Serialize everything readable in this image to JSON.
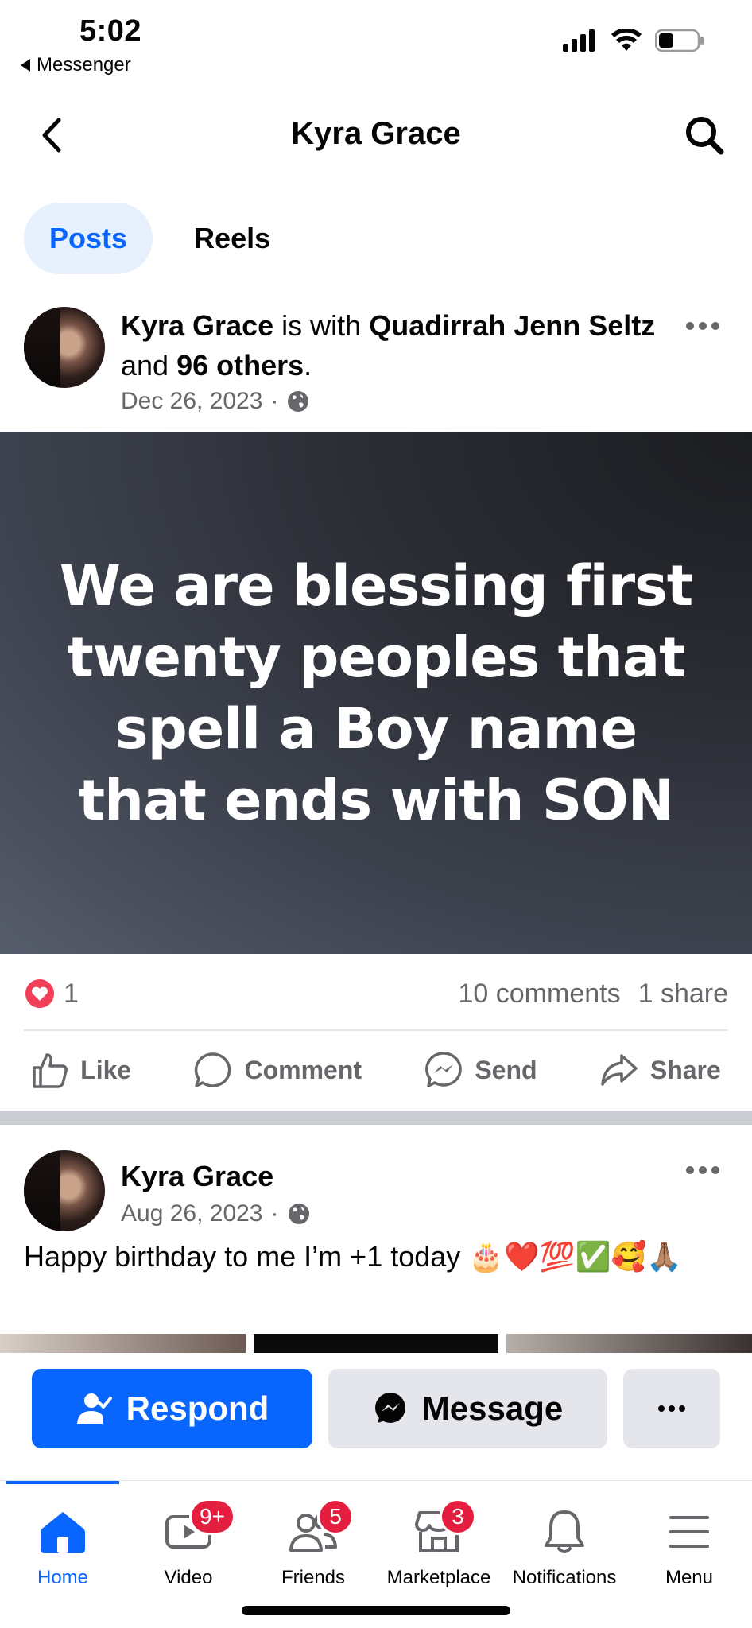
{
  "status_bar": {
    "time": "5:02",
    "back_app": "Messenger"
  },
  "header": {
    "title": "Kyra Grace",
    "back_icon": "chevron-left-icon",
    "search_icon": "search-icon"
  },
  "tabs": [
    {
      "label": "Posts",
      "active": true
    },
    {
      "label": "Reels",
      "active": false
    }
  ],
  "post1": {
    "author": "Kyra Grace",
    "with_text": "is with",
    "tagged": "Quadirrah Jenn Seltz",
    "and_text": "and",
    "others": "96 others",
    "date": "Dec 26, 2023",
    "privacy_icon": "globe-icon",
    "background_text": "We are blessing first twenty peoples that spell a Boy name that ends with SON",
    "reaction_count": "1",
    "comments": "10 comments",
    "shares": "1 share",
    "actions": {
      "like": "Like",
      "comment": "Comment",
      "send": "Send",
      "share": "Share"
    }
  },
  "post2": {
    "author": "Kyra Grace",
    "date": "Aug 26, 2023",
    "text": "Happy birthday to me I’m +1 today 🎂❤️💯✅🥰🙏🏽"
  },
  "cta": {
    "respond": "Respond",
    "message": "Message"
  },
  "tab_bar": [
    {
      "label": "Home",
      "badge": ""
    },
    {
      "label": "Video",
      "badge": "9+"
    },
    {
      "label": "Friends",
      "badge": "5"
    },
    {
      "label": "Marketplace",
      "badge": "3"
    },
    {
      "label": "Notifications",
      "badge": ""
    },
    {
      "label": "Menu",
      "badge": ""
    }
  ],
  "colors": {
    "accent": "#0866ff",
    "badge": "#e41e3f",
    "love": "#f33e58"
  }
}
